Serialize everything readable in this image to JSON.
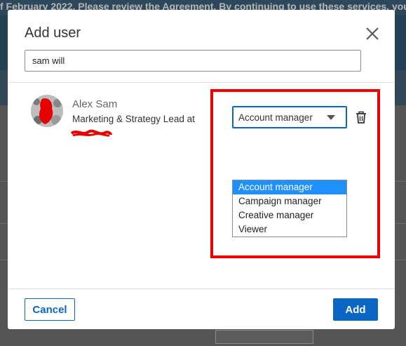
{
  "background": {
    "banner_text_pre": "f February 2022. Please review the ",
    "banner_link": "Agreement",
    "banner_text_post": ". By continuing to use these services, you agre"
  },
  "modal": {
    "title": "Add user",
    "close_icon": "close-icon",
    "search": {
      "value": "sam will",
      "placeholder": ""
    }
  },
  "user": {
    "name": "Alex Sam",
    "title": "Marketing & Strategy Lead at",
    "role_selected": "Account manager",
    "role_options": [
      "Account manager",
      "Campaign manager",
      "Creative manager",
      "Viewer"
    ],
    "delete_icon": "trash-icon"
  },
  "footer": {
    "cancel_label": "Cancel",
    "add_label": "Add"
  },
  "colors": {
    "accent": "#0a66c2",
    "highlight_border": "#ee0000",
    "option_selected": "#1e90ff"
  }
}
